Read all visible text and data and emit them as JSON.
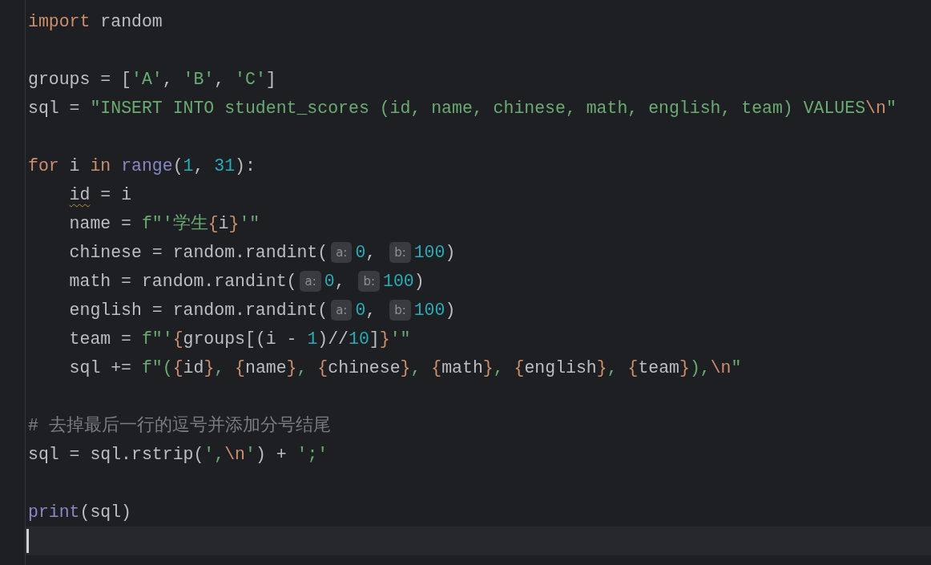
{
  "editor": {
    "lines": [
      {
        "kind": "code",
        "tokens": [
          {
            "kind": "kw",
            "text": "import"
          },
          {
            "kind": "plain",
            "text": " random"
          }
        ]
      },
      {
        "kind": "blank"
      },
      {
        "kind": "code",
        "tokens": [
          {
            "kind": "plain",
            "text": "groups = ["
          },
          {
            "kind": "str",
            "text": "'A'"
          },
          {
            "kind": "plain",
            "text": ", "
          },
          {
            "kind": "str",
            "text": "'B'"
          },
          {
            "kind": "plain",
            "text": ", "
          },
          {
            "kind": "str",
            "text": "'C'"
          },
          {
            "kind": "plain",
            "text": "]"
          }
        ]
      },
      {
        "kind": "code",
        "tokens": [
          {
            "kind": "plain",
            "text": "sql = "
          },
          {
            "kind": "str",
            "text": "\"INSERT INTO student_scores (id, name, chinese, math, english, team) VALUES"
          },
          {
            "kind": "esc",
            "text": "\\n"
          },
          {
            "kind": "str",
            "text": "\""
          }
        ]
      },
      {
        "kind": "blank"
      },
      {
        "kind": "code",
        "tokens": [
          {
            "kind": "kw",
            "text": "for"
          },
          {
            "kind": "plain",
            "text": " i "
          },
          {
            "kind": "kw",
            "text": "in "
          },
          {
            "kind": "builtin",
            "text": "range"
          },
          {
            "kind": "plain",
            "text": "("
          },
          {
            "kind": "num",
            "text": "1"
          },
          {
            "kind": "plain",
            "text": ", "
          },
          {
            "kind": "num",
            "text": "31"
          },
          {
            "kind": "plain",
            "text": "):"
          }
        ]
      },
      {
        "kind": "code",
        "tokens": [
          {
            "kind": "warn",
            "text": "    id"
          },
          {
            "kind": "plain",
            "text": " = i"
          }
        ]
      },
      {
        "kind": "code",
        "tokens": [
          {
            "kind": "plain",
            "text": "    name = "
          },
          {
            "kind": "str",
            "text": "f\"'学生"
          },
          {
            "kind": "brace",
            "text": "{"
          },
          {
            "kind": "plain",
            "text": "i"
          },
          {
            "kind": "brace",
            "text": "}"
          },
          {
            "kind": "str",
            "text": "'\""
          }
        ]
      },
      {
        "kind": "code",
        "tokens": [
          {
            "kind": "plain",
            "text": "    chinese = random.randint("
          },
          {
            "kind": "hint",
            "text": "a:"
          },
          {
            "kind": "num",
            "text": "0"
          },
          {
            "kind": "plain",
            "text": ", "
          },
          {
            "kind": "hint",
            "text": "b:"
          },
          {
            "kind": "num",
            "text": "100"
          },
          {
            "kind": "plain",
            "text": ")"
          }
        ]
      },
      {
        "kind": "code",
        "tokens": [
          {
            "kind": "plain",
            "text": "    math = random.randint("
          },
          {
            "kind": "hint",
            "text": "a:"
          },
          {
            "kind": "num",
            "text": "0"
          },
          {
            "kind": "plain",
            "text": ", "
          },
          {
            "kind": "hint",
            "text": "b:"
          },
          {
            "kind": "num",
            "text": "100"
          },
          {
            "kind": "plain",
            "text": ")"
          }
        ]
      },
      {
        "kind": "code",
        "tokens": [
          {
            "kind": "plain",
            "text": "    english = random.randint("
          },
          {
            "kind": "hint",
            "text": "a:"
          },
          {
            "kind": "num",
            "text": "0"
          },
          {
            "kind": "plain",
            "text": ", "
          },
          {
            "kind": "hint",
            "text": "b:"
          },
          {
            "kind": "num",
            "text": "100"
          },
          {
            "kind": "plain",
            "text": ")"
          }
        ]
      },
      {
        "kind": "code",
        "tokens": [
          {
            "kind": "plain",
            "text": "    team = "
          },
          {
            "kind": "str",
            "text": "f\"'"
          },
          {
            "kind": "brace",
            "text": "{"
          },
          {
            "kind": "plain",
            "text": "groups[(i - "
          },
          {
            "kind": "num",
            "text": "1"
          },
          {
            "kind": "plain",
            "text": ")//"
          },
          {
            "kind": "num",
            "text": "10"
          },
          {
            "kind": "plain",
            "text": "]"
          },
          {
            "kind": "brace",
            "text": "}"
          },
          {
            "kind": "str",
            "text": "'\""
          }
        ]
      },
      {
        "kind": "code",
        "tokens": [
          {
            "kind": "plain",
            "text": "    sql += "
          },
          {
            "kind": "str",
            "text": "f\"("
          },
          {
            "kind": "brace",
            "text": "{"
          },
          {
            "kind": "plain",
            "text": "id"
          },
          {
            "kind": "brace",
            "text": "}"
          },
          {
            "kind": "str",
            "text": ", "
          },
          {
            "kind": "brace",
            "text": "{"
          },
          {
            "kind": "plain",
            "text": "name"
          },
          {
            "kind": "brace",
            "text": "}"
          },
          {
            "kind": "str",
            "text": ", "
          },
          {
            "kind": "brace",
            "text": "{"
          },
          {
            "kind": "plain",
            "text": "chinese"
          },
          {
            "kind": "brace",
            "text": "}"
          },
          {
            "kind": "str",
            "text": ", "
          },
          {
            "kind": "brace",
            "text": "{"
          },
          {
            "kind": "plain",
            "text": "math"
          },
          {
            "kind": "brace",
            "text": "}"
          },
          {
            "kind": "str",
            "text": ", "
          },
          {
            "kind": "brace",
            "text": "{"
          },
          {
            "kind": "plain",
            "text": "english"
          },
          {
            "kind": "brace",
            "text": "}"
          },
          {
            "kind": "str",
            "text": ", "
          },
          {
            "kind": "brace",
            "text": "{"
          },
          {
            "kind": "plain",
            "text": "team"
          },
          {
            "kind": "brace",
            "text": "}"
          },
          {
            "kind": "str",
            "text": "),"
          },
          {
            "kind": "esc",
            "text": "\\n"
          },
          {
            "kind": "str",
            "text": "\""
          }
        ]
      },
      {
        "kind": "blank"
      },
      {
        "kind": "code",
        "tokens": [
          {
            "kind": "comment",
            "text": "# 去掉最后一行的逗号并添加分号结尾"
          }
        ]
      },
      {
        "kind": "code",
        "tokens": [
          {
            "kind": "plain",
            "text": "sql = sql.rstrip("
          },
          {
            "kind": "str",
            "text": "',"
          },
          {
            "kind": "esc",
            "text": "\\n"
          },
          {
            "kind": "str",
            "text": "'"
          },
          {
            "kind": "plain",
            "text": ") + "
          },
          {
            "kind": "str",
            "text": "';'"
          }
        ]
      },
      {
        "kind": "blank"
      },
      {
        "kind": "code",
        "tokens": [
          {
            "kind": "builtin",
            "text": "print"
          },
          {
            "kind": "plain",
            "text": "(sql)"
          }
        ]
      },
      {
        "kind": "current"
      }
    ]
  }
}
